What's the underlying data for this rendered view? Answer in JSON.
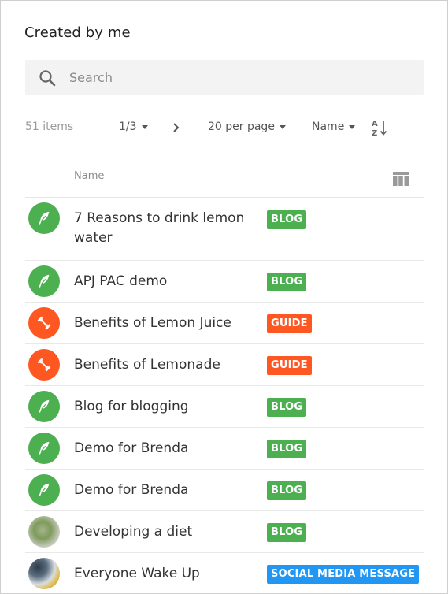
{
  "panel": {
    "title": "Created by me"
  },
  "search": {
    "placeholder": "Search",
    "icon": "search-icon"
  },
  "toolbar": {
    "count": "51 items",
    "page": "1/3",
    "per_page": "20 per page",
    "sort_by": "Name"
  },
  "table": {
    "column_name": "Name",
    "rows": [
      {
        "name": "7 Reasons to drink lemon water",
        "type": "BLOG",
        "avatar": "feather-icon"
      },
      {
        "name": "APJ PAC demo",
        "type": "BLOG",
        "avatar": "feather-icon"
      },
      {
        "name": "Benefits of Lemon Juice",
        "type": "GUIDE",
        "avatar": "dumbbell-icon"
      },
      {
        "name": "Benefits of Lemonade",
        "type": "GUIDE",
        "avatar": "dumbbell-icon"
      },
      {
        "name": "Blog for blogging",
        "type": "BLOG",
        "avatar": "feather-icon"
      },
      {
        "name": "Demo for Brenda",
        "type": "BLOG",
        "avatar": "feather-icon"
      },
      {
        "name": "Demo for Brenda",
        "type": "BLOG",
        "avatar": "feather-icon"
      },
      {
        "name": "Developing a diet",
        "type": "BLOG",
        "avatar": "photo-thumbnail"
      },
      {
        "name": "Everyone Wake Up",
        "type": "SOCIAL MEDIA MESSAGE",
        "avatar": "photo-thumbnail"
      }
    ]
  },
  "colors": {
    "blog": "#4caf50",
    "guide": "#ff5722",
    "social": "#2196f3"
  }
}
